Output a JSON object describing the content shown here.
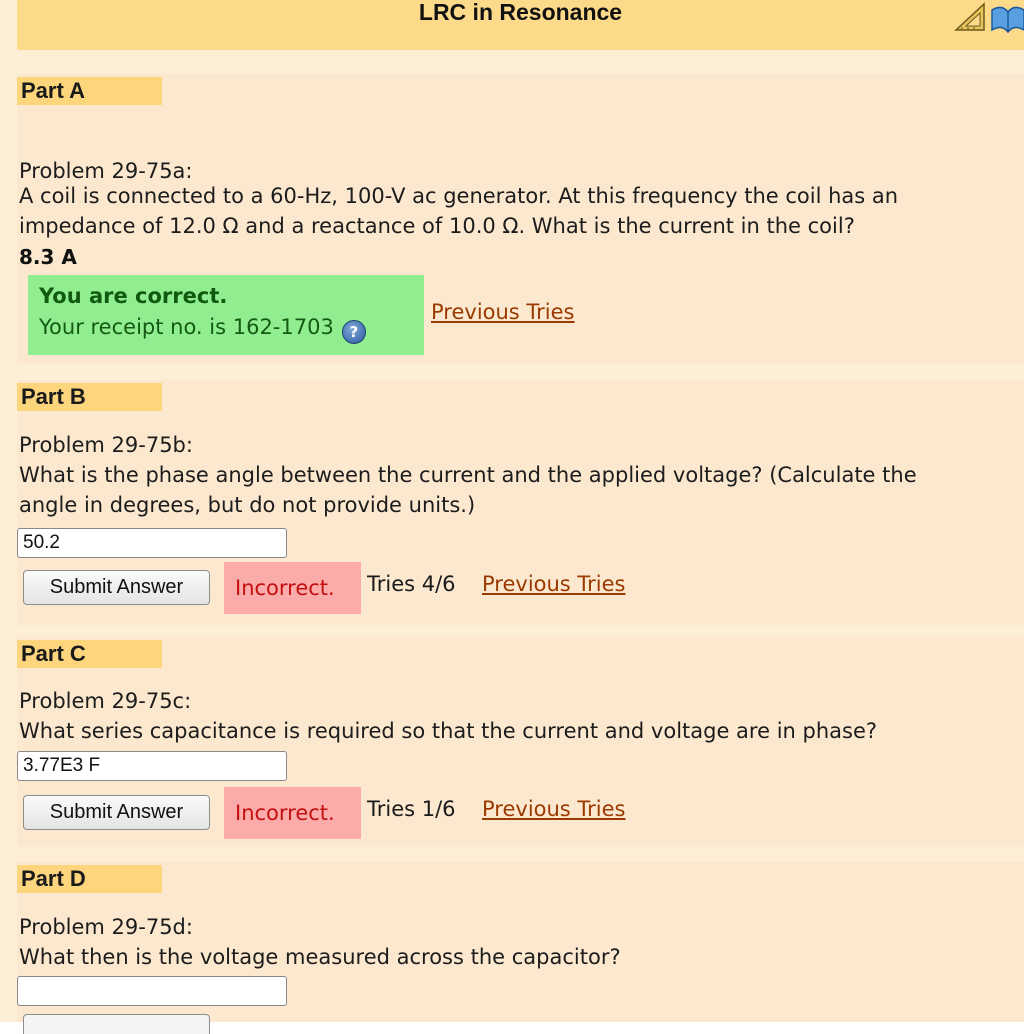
{
  "header": {
    "title": "LRC in Resonance",
    "icons": [
      "ruler-triangle-icon",
      "book-icon"
    ]
  },
  "parts": {
    "a": {
      "label": "Part A",
      "problem_id": "Problem 29-75a:",
      "question_line1": "A coil is connected to a 60-Hz, 100-V ac generator. At this frequency the coil has an",
      "question_line2": "impedance of 12.0 Ω and a reactance of 10.0 Ω. What is the current in the coil?",
      "answer": "8.3 A",
      "feedback_title": "You are correct.",
      "receipt": "Your receipt no. is 162-1703",
      "help_glyph": "?",
      "previous_tries": "Previous Tries"
    },
    "b": {
      "label": "Part B",
      "problem_id": "Problem 29-75b:",
      "question_line1": "What is the phase angle between the current and the applied voltage? (Calculate the",
      "question_line2": "angle in degrees, but do not provide units.)",
      "input_value": "50.2",
      "submit_label": "Submit Answer",
      "status": "Incorrect.",
      "tries": "Tries 4/6",
      "previous_tries": "Previous Tries"
    },
    "c": {
      "label": "Part C",
      "problem_id": "Problem 29-75c:",
      "question_line1": "What series capacitance is required so that the current and voltage are in phase?",
      "input_value": "3.77E3 F",
      "submit_label": "Submit Answer",
      "status": "Incorrect.",
      "tries": "Tries 1/6",
      "previous_tries": "Previous Tries"
    },
    "d": {
      "label": "Part D",
      "problem_id": "Problem 29-75d:",
      "question_line1": "What then is the voltage measured across the capacitor?",
      "input_value": ""
    }
  },
  "colors": {
    "page_background": "#fdefd6",
    "header_background": "#fdd98a",
    "part_label_background": "#fdd57d",
    "correct_background": "#90ee90",
    "correct_text": "#0f5a0f",
    "incorrect_background": "#fcabab",
    "incorrect_text": "#c41010",
    "link": "#9b3a00"
  }
}
